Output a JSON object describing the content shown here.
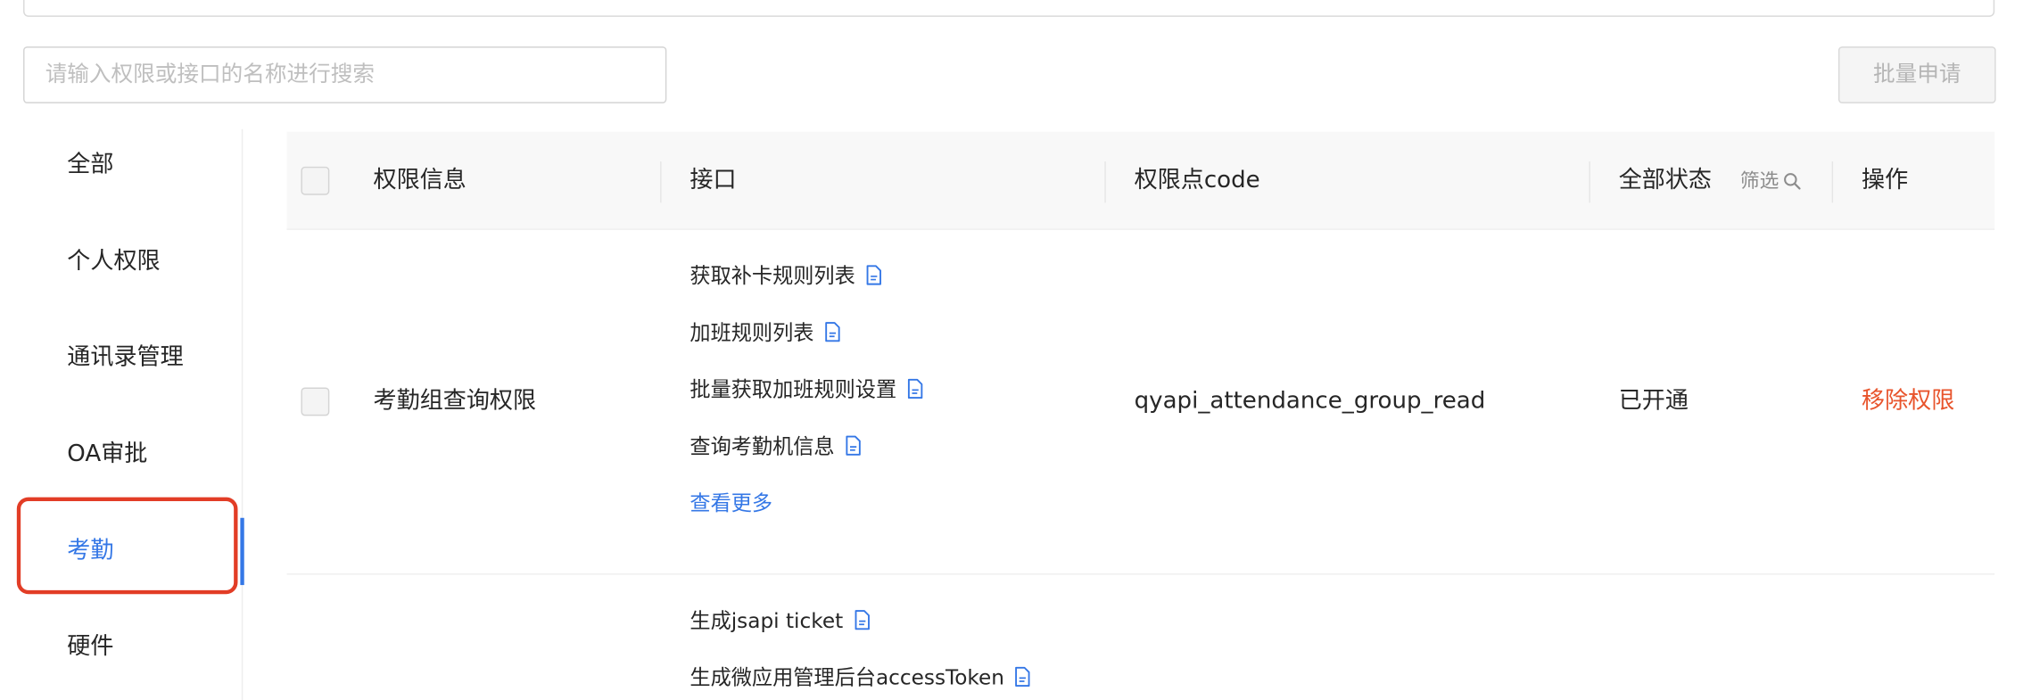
{
  "search": {
    "placeholder": "请输入权限或接口的名称进行搜索"
  },
  "toolbar": {
    "bulk_apply_label": "批量申请"
  },
  "sidebar": {
    "items": [
      {
        "label": "全部"
      },
      {
        "label": "个人权限"
      },
      {
        "label": "通讯录管理"
      },
      {
        "label": "OA审批"
      },
      {
        "label": "考勤",
        "active": true
      },
      {
        "label": "硬件"
      }
    ]
  },
  "table": {
    "headers": {
      "permission_info": "权限信息",
      "interface": "接口",
      "code": "权限点code",
      "status": "全部状态",
      "filter": "筛选",
      "action": "操作"
    },
    "rows": [
      {
        "permission": "考勤组查询权限",
        "apis": [
          "获取补卡规则列表",
          "加班规则列表",
          "批量获取加班规则设置",
          "查询考勤机信息"
        ],
        "more": "查看更多",
        "code": "qyapi_attendance_group_read",
        "status": "已开通",
        "action": "移除权限"
      },
      {
        "permission": "",
        "apis": [
          "生成jsapi ticket",
          "生成微应用管理后台accessToken"
        ]
      }
    ]
  },
  "colors": {
    "accent": "#3477e6",
    "danger": "#e8542c",
    "highlight": "#e23d26"
  }
}
